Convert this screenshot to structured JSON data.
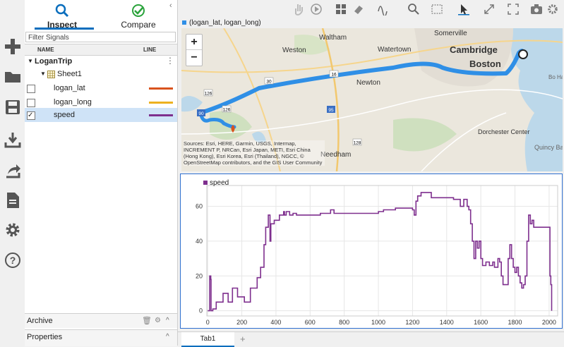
{
  "panel": {
    "inspect_label": "Inspect",
    "compare_label": "Compare",
    "filter_placeholder": "Filter Signals",
    "col_name": "NAME",
    "col_line": "LINE",
    "run_name": "LoganTrip",
    "sheet_name": "Sheet1",
    "signals": [
      {
        "name": "logan_lat",
        "color": "#d9531e",
        "checked": false
      },
      {
        "name": "logan_long",
        "color": "#edb120",
        "checked": false
      },
      {
        "name": "speed",
        "color": "#7e2f8e",
        "checked": true
      }
    ],
    "archive_label": "Archive",
    "properties_label": "Properties"
  },
  "map": {
    "legend": "(logan_lat, logan_long)",
    "labels": [
      "Waltham",
      "Somerville",
      "Watertown",
      "Cambridge",
      "Weston",
      "Boston",
      "Newton",
      "Dorchester Center",
      "Needham",
      "Quincy Ba",
      "Bo Har"
    ],
    "road_shields": [
      "30",
      "126",
      "128",
      "90",
      "95",
      "16",
      "126"
    ],
    "attribution": "Sources: Esri, HERE, Garmin, USGS, Intermap, INCREMENT P, NRCan, Esri Japan, METI, Esri China (Hong Kong), Esri Korea, Esri (Thailand), NGCC, © OpenStreetMap contributors, and the GIS User Community",
    "zoom_in": "+",
    "zoom_out": "−"
  },
  "tabs": {
    "tab1": "Tab1",
    "add": "+"
  },
  "chart_data": {
    "type": "line",
    "legend": "speed",
    "series": [
      {
        "name": "speed",
        "color": "#7e2f8e"
      }
    ],
    "xlim": [
      -5,
      2050
    ],
    "ylim": [
      -3,
      72
    ],
    "xticks": [
      0,
      200,
      400,
      600,
      800,
      1000,
      1200,
      1400,
      1600,
      1800,
      2000
    ],
    "yticks": [
      0,
      20,
      40,
      60
    ],
    "grid": true,
    "points": [
      [
        0,
        0
      ],
      [
        10,
        0
      ],
      [
        12,
        20
      ],
      [
        18,
        18
      ],
      [
        20,
        0
      ],
      [
        30,
        1
      ],
      [
        40,
        1
      ],
      [
        50,
        5
      ],
      [
        80,
        5
      ],
      [
        90,
        10
      ],
      [
        110,
        10
      ],
      [
        120,
        5
      ],
      [
        140,
        5
      ],
      [
        145,
        13
      ],
      [
        170,
        13
      ],
      [
        175,
        8
      ],
      [
        210,
        8
      ],
      [
        215,
        5
      ],
      [
        240,
        5
      ],
      [
        250,
        13
      ],
      [
        280,
        13
      ],
      [
        290,
        19
      ],
      [
        310,
        25
      ],
      [
        330,
        38
      ],
      [
        340,
        48
      ],
      [
        355,
        55
      ],
      [
        365,
        40
      ],
      [
        370,
        50
      ],
      [
        385,
        50
      ],
      [
        390,
        52
      ],
      [
        410,
        52
      ],
      [
        420,
        55
      ],
      [
        440,
        55
      ],
      [
        445,
        57
      ],
      [
        450,
        55
      ],
      [
        460,
        57
      ],
      [
        480,
        55
      ],
      [
        500,
        56
      ],
      [
        520,
        55
      ],
      [
        600,
        55
      ],
      [
        640,
        55
      ],
      [
        660,
        56
      ],
      [
        700,
        56
      ],
      [
        720,
        58
      ],
      [
        740,
        56
      ],
      [
        780,
        56
      ],
      [
        800,
        56
      ],
      [
        900,
        56
      ],
      [
        980,
        56
      ],
      [
        1000,
        57
      ],
      [
        1030,
        58
      ],
      [
        1060,
        58
      ],
      [
        1100,
        59
      ],
      [
        1150,
        59
      ],
      [
        1190,
        59
      ],
      [
        1200,
        58
      ],
      [
        1210,
        55
      ],
      [
        1220,
        63
      ],
      [
        1230,
        66
      ],
      [
        1240,
        66
      ],
      [
        1250,
        68
      ],
      [
        1300,
        68
      ],
      [
        1310,
        65
      ],
      [
        1400,
        65
      ],
      [
        1420,
        65
      ],
      [
        1440,
        64
      ],
      [
        1470,
        64
      ],
      [
        1480,
        60
      ],
      [
        1500,
        64
      ],
      [
        1520,
        60
      ],
      [
        1530,
        58
      ],
      [
        1540,
        50
      ],
      [
        1550,
        40
      ],
      [
        1560,
        30
      ],
      [
        1570,
        40
      ],
      [
        1580,
        36
      ],
      [
        1590,
        40
      ],
      [
        1600,
        30
      ],
      [
        1610,
        26
      ],
      [
        1630,
        28
      ],
      [
        1650,
        26
      ],
      [
        1670,
        28
      ],
      [
        1680,
        25
      ],
      [
        1700,
        30
      ],
      [
        1710,
        28
      ],
      [
        1720,
        20
      ],
      [
        1730,
        15
      ],
      [
        1750,
        15
      ],
      [
        1760,
        30
      ],
      [
        1770,
        38
      ],
      [
        1780,
        30
      ],
      [
        1790,
        25
      ],
      [
        1800,
        22
      ],
      [
        1810,
        25
      ],
      [
        1820,
        20
      ],
      [
        1830,
        16
      ],
      [
        1840,
        13
      ],
      [
        1850,
        15
      ],
      [
        1860,
        20
      ],
      [
        1870,
        40
      ],
      [
        1880,
        55
      ],
      [
        1890,
        50
      ],
      [
        1900,
        52
      ],
      [
        1910,
        48
      ],
      [
        1950,
        48
      ],
      [
        1990,
        48
      ],
      [
        2000,
        48
      ],
      [
        2005,
        20
      ],
      [
        2010,
        15
      ],
      [
        2015,
        0
      ]
    ]
  }
}
